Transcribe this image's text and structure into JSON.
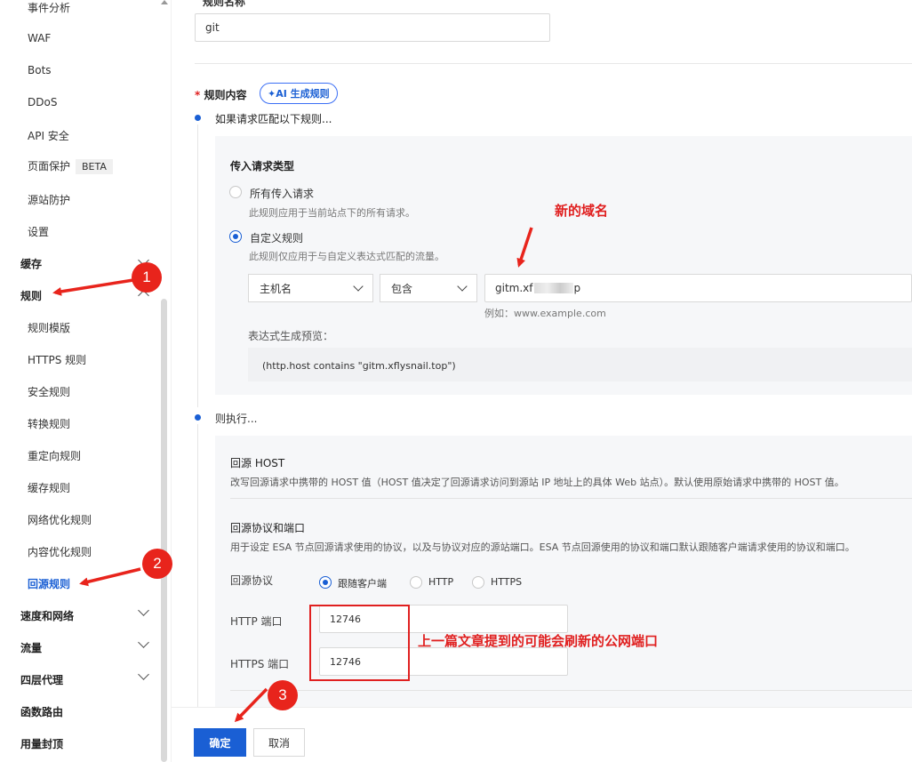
{
  "sidebar": {
    "items": [
      {
        "label": "事件分析"
      },
      {
        "label": "WAF"
      },
      {
        "label": "Bots"
      },
      {
        "label": "DDoS"
      },
      {
        "label": "API 安全"
      },
      {
        "label": "页面保护",
        "badge": "BETA"
      },
      {
        "label": "源站防护"
      },
      {
        "label": "设置"
      }
    ],
    "group_cache": "缓存",
    "group_rules": "规则",
    "rule_items": [
      {
        "label": "规则模版"
      },
      {
        "label": "HTTPS 规则"
      },
      {
        "label": "安全规则"
      },
      {
        "label": "转换规则"
      },
      {
        "label": "重定向规则"
      },
      {
        "label": "缓存规则"
      },
      {
        "label": "网络优化规则"
      },
      {
        "label": "内容优化规则"
      },
      {
        "label": "回源规则"
      }
    ],
    "groups_bottom": [
      {
        "label": "速度和网络"
      },
      {
        "label": "流量"
      },
      {
        "label": "四层代理"
      },
      {
        "label": "函数路由"
      },
      {
        "label": "用量封顶"
      }
    ]
  },
  "form": {
    "rule_name_label": "规则名称",
    "rule_name_value": "git",
    "rule_content_label": "规则内容",
    "required_mark": "*",
    "ai_button": "AI 生成规则",
    "if_match_label": "如果请求匹配以下规则...",
    "incoming_type_title": "传入请求类型",
    "all_requests": {
      "label": "所有传入请求",
      "desc": "此规则应用于当前站点下的所有请求。"
    },
    "custom_rule": {
      "label": "自定义规则",
      "desc": "此规则仅应用于与自定义表达式匹配的流量。"
    },
    "field_select": "主机名",
    "operator_select": "包含",
    "value_input": "gitm.xf",
    "value_tail": "p",
    "value_example": "例如：www.example.com",
    "preview_label": "表达式生成预览：",
    "preview_expression": "(http.host contains \"gitm.xflysnail.top\")",
    "then_label": "则执行...",
    "origin_host": {
      "title": "回源 HOST",
      "desc": "改写回源请求中携带的 HOST 值（HOST 值决定了回源请求访问到源站 IP 地址上的具体 Web 站点）。默认使用原始请求中携带的 HOST 值。"
    },
    "origin_protocol": {
      "title": "回源协议和端口",
      "desc": "用于设定 ESA 节点回源请求使用的协议，以及与协议对应的源站端口。ESA 节点回源使用的协议和端口默认跟随客户端请求使用的协议和端口。",
      "protocol_label": "回源协议",
      "options": [
        "跟随客户端",
        "HTTP",
        "HTTPS"
      ],
      "selected": "跟随客户端",
      "http_port_label": "HTTP 端口",
      "http_port_value": "12746",
      "https_port_label": "HTTPS 端口",
      "https_port_value": "12746"
    },
    "confirm_button": "确定",
    "cancel_button": "取消"
  },
  "annotations": {
    "new_domain": "新的域名",
    "port_note": "上一篇文章提到的可能会刷新的公网端口",
    "step1": "1",
    "step2": "2",
    "step3": "3"
  },
  "colors": {
    "accent": "#1a5fd4",
    "annotation_red": "#e02020",
    "panel_bg": "#f6f7f9"
  }
}
